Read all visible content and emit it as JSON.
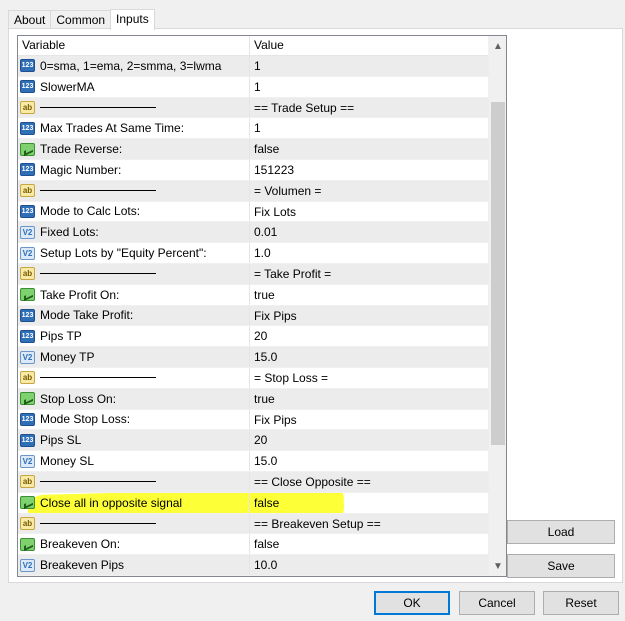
{
  "tabs": [
    {
      "label": "About"
    },
    {
      "label": "Common"
    },
    {
      "label": "Inputs",
      "active": true
    }
  ],
  "grid": {
    "header": {
      "variable": "Variable",
      "value": "Value"
    },
    "rows": [
      {
        "icon": "int",
        "variable": "0=sma, 1=ema, 2=smma, 3=lwma",
        "value": "1"
      },
      {
        "icon": "int",
        "variable": "SlowerMA",
        "value": "1"
      },
      {
        "icon": "str",
        "variable": "",
        "separator": true,
        "value": "== Trade Setup =="
      },
      {
        "icon": "int",
        "variable": "Max Trades At Same Time:",
        "value": "1"
      },
      {
        "icon": "bool",
        "variable": "Trade Reverse:",
        "value": "false"
      },
      {
        "icon": "int",
        "variable": "Magic Number:",
        "value": "151223"
      },
      {
        "icon": "str",
        "variable": "",
        "separator": true,
        "value": "= Volumen ="
      },
      {
        "icon": "int",
        "variable": "Mode to Calc Lots:",
        "value": "Fix Lots"
      },
      {
        "icon": "dbl",
        "variable": "Fixed Lots:",
        "value": "0.01"
      },
      {
        "icon": "dbl",
        "variable": "Setup Lots by \"Equity Percent\":",
        "value": "1.0"
      },
      {
        "icon": "str",
        "variable": "",
        "separator": true,
        "value": "= Take Profit ="
      },
      {
        "icon": "bool",
        "variable": "Take Profit On:",
        "value": "true"
      },
      {
        "icon": "int",
        "variable": "Mode Take Profit:",
        "value": "Fix Pips"
      },
      {
        "icon": "int",
        "variable": "Pips TP",
        "value": "20"
      },
      {
        "icon": "dbl",
        "variable": "Money TP",
        "value": "15.0"
      },
      {
        "icon": "str",
        "variable": "",
        "separator": true,
        "value": "= Stop Loss ="
      },
      {
        "icon": "bool",
        "variable": "Stop Loss On:",
        "value": "true"
      },
      {
        "icon": "int",
        "variable": "Mode Stop Loss:",
        "value": "Fix Pips"
      },
      {
        "icon": "int",
        "variable": "Pips SL",
        "value": "20"
      },
      {
        "icon": "dbl",
        "variable": "Money SL",
        "value": "15.0"
      },
      {
        "icon": "str",
        "variable": "",
        "separator": true,
        "value": "== Close Opposite =="
      },
      {
        "icon": "bool",
        "variable": "Close all in opposite signal",
        "value": "false",
        "highlighted": true
      },
      {
        "icon": "str",
        "variable": "",
        "separator": true,
        "value": "== Breakeven Setup =="
      },
      {
        "icon": "bool",
        "variable": "Breakeven On:",
        "value": "false"
      },
      {
        "icon": "dbl",
        "variable": "Breakeven Pips",
        "value": "10.0"
      }
    ]
  },
  "icon_glyphs": {
    "int": "123",
    "dbl": "V2",
    "bool": "",
    "str": "ab"
  },
  "buttons": {
    "load": "Load",
    "save": "Save",
    "ok": "OK",
    "cancel": "Cancel",
    "reset": "Reset"
  },
  "colors": {
    "highlight": "#fdff2c",
    "focus": "#0078d7"
  }
}
